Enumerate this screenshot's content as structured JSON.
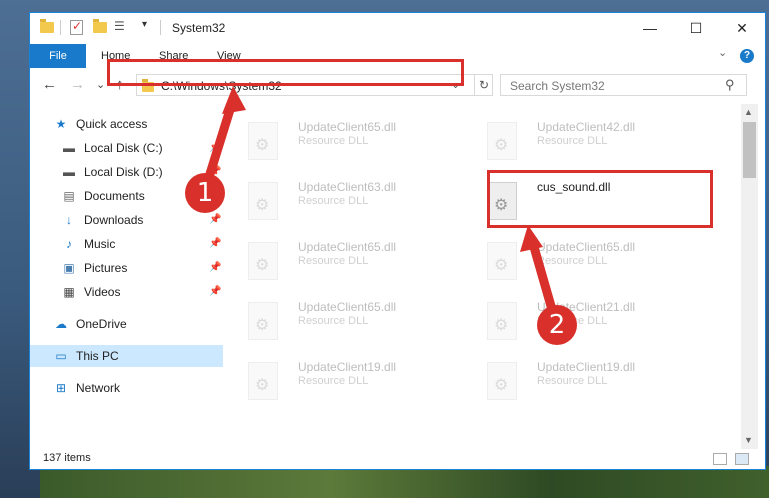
{
  "window": {
    "title": "System32",
    "controls": {
      "minimize": "—",
      "maximize": "☐",
      "close": "✕"
    }
  },
  "ribbon": {
    "tabs": [
      "File",
      "Home",
      "Share",
      "View"
    ],
    "help": "?",
    "collapse": "⌄"
  },
  "nav": {
    "back": "←",
    "forward": "→",
    "recent": "⌄",
    "up": "↑",
    "address": "C:\\Windows\\System32",
    "address_drop": "⌄",
    "refresh": "↻",
    "search_placeholder": "Search System32",
    "search_icon_glyph": "⚲"
  },
  "sidebar": {
    "items": [
      {
        "label": "Quick access",
        "icon": "star-icon",
        "glyph": "★",
        "color": "#1979ca",
        "pinned": false
      },
      {
        "label": "Local Disk (C:)",
        "icon": "drive-icon",
        "glyph": "▬",
        "color": "#555555",
        "pinned": true
      },
      {
        "label": "Local Disk (D:)",
        "icon": "drive-icon",
        "glyph": "▬",
        "color": "#555555",
        "pinned": true
      },
      {
        "label": "Documents",
        "icon": "documents-icon",
        "glyph": "▤",
        "color": "#666666",
        "pinned": true
      },
      {
        "label": "Downloads",
        "icon": "download-icon",
        "glyph": "↓",
        "color": "#1979ca",
        "pinned": true
      },
      {
        "label": "Music",
        "icon": "music-icon",
        "glyph": "♪",
        "color": "#1979ca",
        "pinned": true
      },
      {
        "label": "Pictures",
        "icon": "pictures-icon",
        "glyph": "▣",
        "color": "#4a7fb0",
        "pinned": true
      },
      {
        "label": "Videos",
        "icon": "videos-icon",
        "glyph": "▦",
        "color": "#444444",
        "pinned": true
      },
      {
        "label": "OneDrive",
        "icon": "cloud-icon",
        "glyph": "☁",
        "color": "#1979ca",
        "pinned": false
      },
      {
        "label": "This PC",
        "icon": "computer-icon",
        "glyph": "▭",
        "color": "#1979ca",
        "pinned": false,
        "selected": true
      },
      {
        "label": "Network",
        "icon": "network-icon",
        "glyph": "⊞",
        "color": "#1979ca",
        "pinned": false
      }
    ],
    "pin_glyph": "📌"
  },
  "files": {
    "left_column": [
      {
        "name": "UpdateClient65.dll",
        "type": "Resource DLL"
      },
      {
        "name": "UpdateClient63.dll",
        "type": "Resource DLL"
      },
      {
        "name": "UpdateClient65.dll",
        "type": "Resource DLL"
      },
      {
        "name": "UpdateClient65.dll",
        "type": "Resource DLL"
      },
      {
        "name": "UpdateClient19.dll",
        "type": "Resource DLL"
      }
    ],
    "right_column": [
      {
        "name": "UpdateClient42.dll",
        "type": "Resource DLL"
      },
      {
        "name": "cus_sound.dll",
        "type": ""
      },
      {
        "name": "UpdateClient65.dll",
        "type": "Resource DLL"
      },
      {
        "name": "UpdateClient21.dll",
        "type": "Resource DLL"
      },
      {
        "name": "UpdateClient19.dll",
        "type": "Resource DLL"
      }
    ]
  },
  "status": {
    "item_count": "137 items"
  },
  "annotations": {
    "badge1": "1",
    "badge2": "2",
    "highlight_color": "#d9302b"
  }
}
